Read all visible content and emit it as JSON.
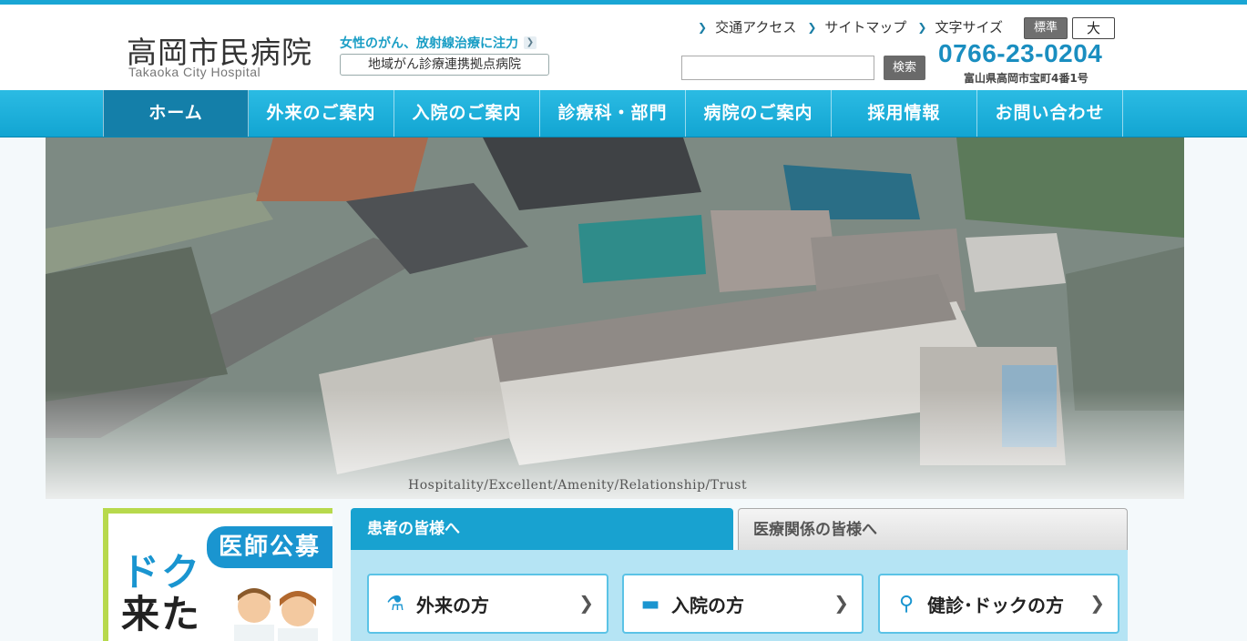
{
  "header": {
    "logo_jp": "高岡市民病院",
    "logo_en": "Takaoka City Hospital",
    "tagline": "女性のがん、放射線治療に注力",
    "designation": "地域がん診療連携拠点病院",
    "util_links": [
      "交通アクセス",
      "サイトマップ",
      "文字サイズ"
    ],
    "font_size_normal": "標準",
    "font_size_large": "大",
    "search_button": "検索",
    "search_value": "",
    "phone": "0766-23-0204",
    "address": "富山県高岡市宝町4番1号"
  },
  "nav": {
    "items": [
      "ホーム",
      "外来のご案内",
      "入院のご案内",
      "診療科・部門",
      "病院のご案内",
      "採用情報",
      "お問い合わせ"
    ]
  },
  "hero": {
    "caption": "Hospitality/Excellent/Amenity/Relationship/Trust"
  },
  "recruit": {
    "title": "医師公募",
    "vertical_1": "来た",
    "vertical_2": "ドク"
  },
  "tabs": {
    "patients": "患者の皆様へ",
    "medical": "医療関係の皆様へ"
  },
  "patient_buttons": [
    {
      "label": "外来の方",
      "icon": "stethoscope-icon"
    },
    {
      "label": "入院の方",
      "icon": "bed-icon"
    },
    {
      "label": "健診･ドックの方",
      "icon": "person-search-icon"
    }
  ],
  "colors": {
    "accent": "#1aa6d4",
    "nav_active": "#147fa9",
    "recruit_border": "#b7d94c"
  }
}
